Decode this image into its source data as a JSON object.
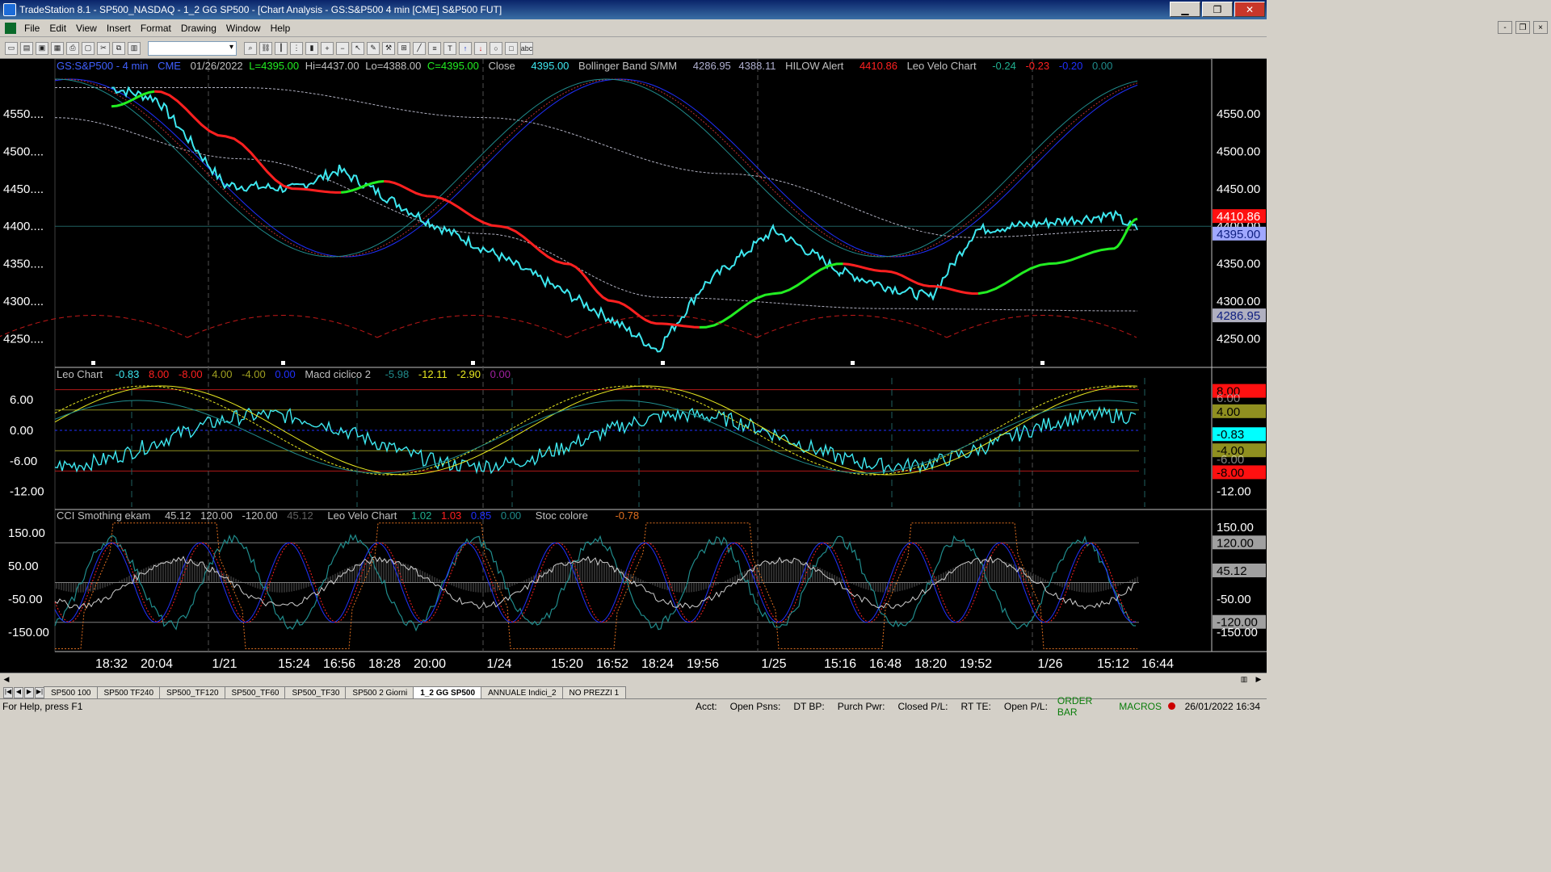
{
  "window": {
    "title": "TradeStation 8.1 - SP500_NASDAQ - 1_2 GG SP500 - [Chart Analysis - GS:S&P500  4 min  [CME] S&P500 FUT]",
    "min": "▁",
    "max": "❐",
    "close": "✕"
  },
  "menu": [
    "File",
    "Edit",
    "View",
    "Insert",
    "Format",
    "Drawing",
    "Window",
    "Help"
  ],
  "mdi": {
    "min": "-",
    "restore": "❐",
    "close": "×"
  },
  "toolbar_icons": [
    "new",
    "open",
    "save",
    "saveall",
    "print",
    "preview",
    "cut",
    "copy",
    "paste",
    "find",
    "link",
    "bars",
    "dots",
    "cand",
    "zoomin",
    "zoomout",
    "cursor",
    "draw",
    "tools",
    "insert",
    "line",
    "fib",
    "text",
    "arrowup",
    "arrowdn",
    "circle",
    "rect",
    "abc"
  ],
  "legend_main": {
    "symbol": "GS:S&P500 - 4 min",
    "exch": "CME",
    "date": "01/26/2022",
    "low_label": "L=4395.00",
    "hi": "Hi=4437.00",
    "lo": "Lo=4388.00",
    "close_c": "C=4395.00",
    "close_label": "Close",
    "close_val": "4395.00",
    "bb_label": "Bollinger Band S/MM",
    "bb1": "4286.95",
    "bb2": "4388.11",
    "hilow_label": "HILOW Alert",
    "hilow_val": "4410.86",
    "velo_label": "Leo Velo Chart",
    "v1": "-0.24",
    "v2": "-0.23",
    "v3": "-0.20",
    "v4": "0.00"
  },
  "legend_mid": {
    "label": "Leo Chart",
    "v1": "-0.83",
    "v2": "8.00",
    "v3": "-8.00",
    "v4": "4.00",
    "v5": "-4.00",
    "v6": "0.00",
    "macd_label": "Macd ciclico 2",
    "m1": "-5.98",
    "m2": "-12.11",
    "m3": "-2.90",
    "m4": "0.00"
  },
  "legend_low": {
    "label": "CCI Smothing ekam",
    "c1": "45.12",
    "c2": "120.00",
    "c3": "-120.00",
    "c4": "45.12",
    "velo_label": "Leo Velo Chart",
    "v1": "1.02",
    "v2": "1.03",
    "v3": "0.85",
    "v4": "0.00",
    "stoc_label": "Stoc colore",
    "s1": "-0.78"
  },
  "axes": {
    "main_ticks": [
      "4550.00",
      "4500.00",
      "4450.00",
      "4400.00",
      "4350.00",
      "4300.00",
      "4250.00"
    ],
    "main_left_ticks": [
      "4550....",
      "4500....",
      "4450....",
      "4400....",
      "4350....",
      "4300....",
      "4250...."
    ],
    "main_tags": {
      "red": "4410.86",
      "blue": "4395.00",
      "gray": "4286.95"
    },
    "mid_ticks": [
      "6.00",
      "0.00",
      "-6.00",
      "-12.00"
    ],
    "mid_right_ticks": [
      "-6.00",
      "-12.00"
    ],
    "mid_tags": {
      "red_top": "8.00",
      "olive_top": "4.00",
      "cyan": "-0.83",
      "olive_bot": "-4.00",
      "red_bot": "-8.00",
      "hidden_a": "6.00",
      "hidden_b": "-6.00"
    },
    "low_ticks": [
      "150.00",
      "50.00",
      "-50.00",
      "-150.00"
    ],
    "low_right_ticks": [
      "150.00",
      "-50.00",
      "-150.00"
    ],
    "low_tags": {
      "top": "120.00",
      "mid": "45.12",
      "bot": "-120.00"
    },
    "time_labels": [
      "18:32",
      "20:04",
      "1/21",
      "15:24",
      "16:56",
      "18:28",
      "20:00",
      "1/24",
      "15:20",
      "16:52",
      "18:24",
      "19:56",
      "1/25",
      "15:16",
      "16:48",
      "18:20",
      "19:52",
      "1/26",
      "15:12",
      "16:44"
    ]
  },
  "tabs": [
    "SP500 100",
    "SP500 TF240",
    "SP500_TF120",
    "SP500_TF60",
    "SP500_TF30",
    "SP500 2 Giorni",
    "1_2 GG SP500",
    "ANNUALE Indici_2",
    "NO PREZZI 1"
  ],
  "active_tab": "1_2 GG SP500",
  "status": {
    "help": "For Help, press F1",
    "acct": "Acct:",
    "open_psns": "Open Psns:",
    "dtbp": "DT BP:",
    "purch": "Purch Pwr:",
    "closed_pl": "Closed P/L:",
    "rt_te": "RT TE:",
    "open_pl": "Open P/L:",
    "orderbar": "ORDER BAR",
    "macros": "MACROS",
    "datetime": "26/01/2022 16:34"
  },
  "colors": {
    "price": "#3ee8f0",
    "red": "#ff2020",
    "green": "#22ee22",
    "blue": "#2030ff",
    "teal": "#208c8c",
    "yellow": "#e8e820"
  },
  "chart_data": {
    "type": "line",
    "title": "GS:S&P500 - 4 min",
    "ylim": [
      4220,
      4600
    ],
    "x": [
      "18:32",
      "20:04",
      "1/21",
      "15:24",
      "16:56",
      "18:28",
      "20:00",
      "1/24",
      "15:20",
      "16:52",
      "18:24",
      "19:56",
      "1/25",
      "15:16",
      "16:48",
      "18:20",
      "19:52",
      "1/26",
      "15:12",
      "16:44"
    ],
    "series": [
      {
        "name": "Close",
        "values": [
          4585,
          4570,
          4455,
          4450,
          4475,
          4440,
          4405,
          4360,
          4310,
          4275,
          4235,
          4320,
          4395,
          4340,
          4320,
          4305,
          4395,
          4405,
          4415,
          4395
        ]
      },
      {
        "name": "Leo Velo Chart",
        "values": [
          4560,
          4580,
          4520,
          4450,
          4445,
          4460,
          4440,
          4400,
          4350,
          4300,
          4270,
          4265,
          4310,
          4350,
          4340,
          4320,
          4310,
          4350,
          4370,
          4410
        ]
      }
    ]
  }
}
